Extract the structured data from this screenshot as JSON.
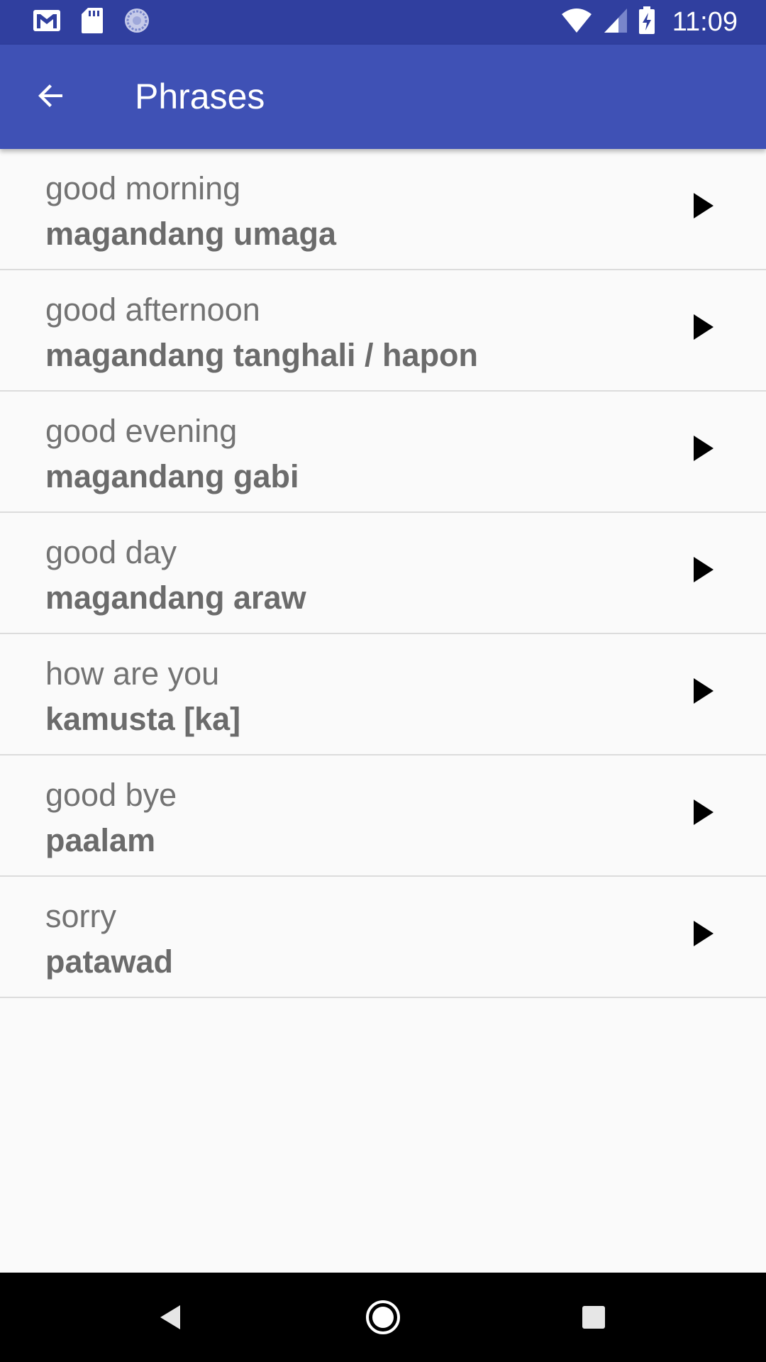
{
  "status_bar": {
    "time": "11:09",
    "icons": [
      "gmail-icon",
      "sd-card-icon",
      "sync-icon",
      "wifi-icon",
      "signal-icon",
      "battery-charging-icon"
    ]
  },
  "app_bar": {
    "title": "Phrases",
    "back_icon": "arrow-back-icon",
    "color": "#3f51b5",
    "status_color": "#303f9f"
  },
  "phrases": [
    {
      "english": "good morning",
      "tagalog": "magandang umaga"
    },
    {
      "english": "good afternoon",
      "tagalog": "magandang tanghali / hapon"
    },
    {
      "english": "good evening",
      "tagalog": "magandang gabi"
    },
    {
      "english": "good day",
      "tagalog": "magandang araw"
    },
    {
      "english": "how are you",
      "tagalog": "kamusta [ka]"
    },
    {
      "english": "good bye",
      "tagalog": "paalam"
    },
    {
      "english": "sorry",
      "tagalog": "patawad"
    }
  ],
  "nav_bar": {
    "icons": [
      "nav-back-icon",
      "nav-home-icon",
      "nav-recents-icon"
    ]
  }
}
